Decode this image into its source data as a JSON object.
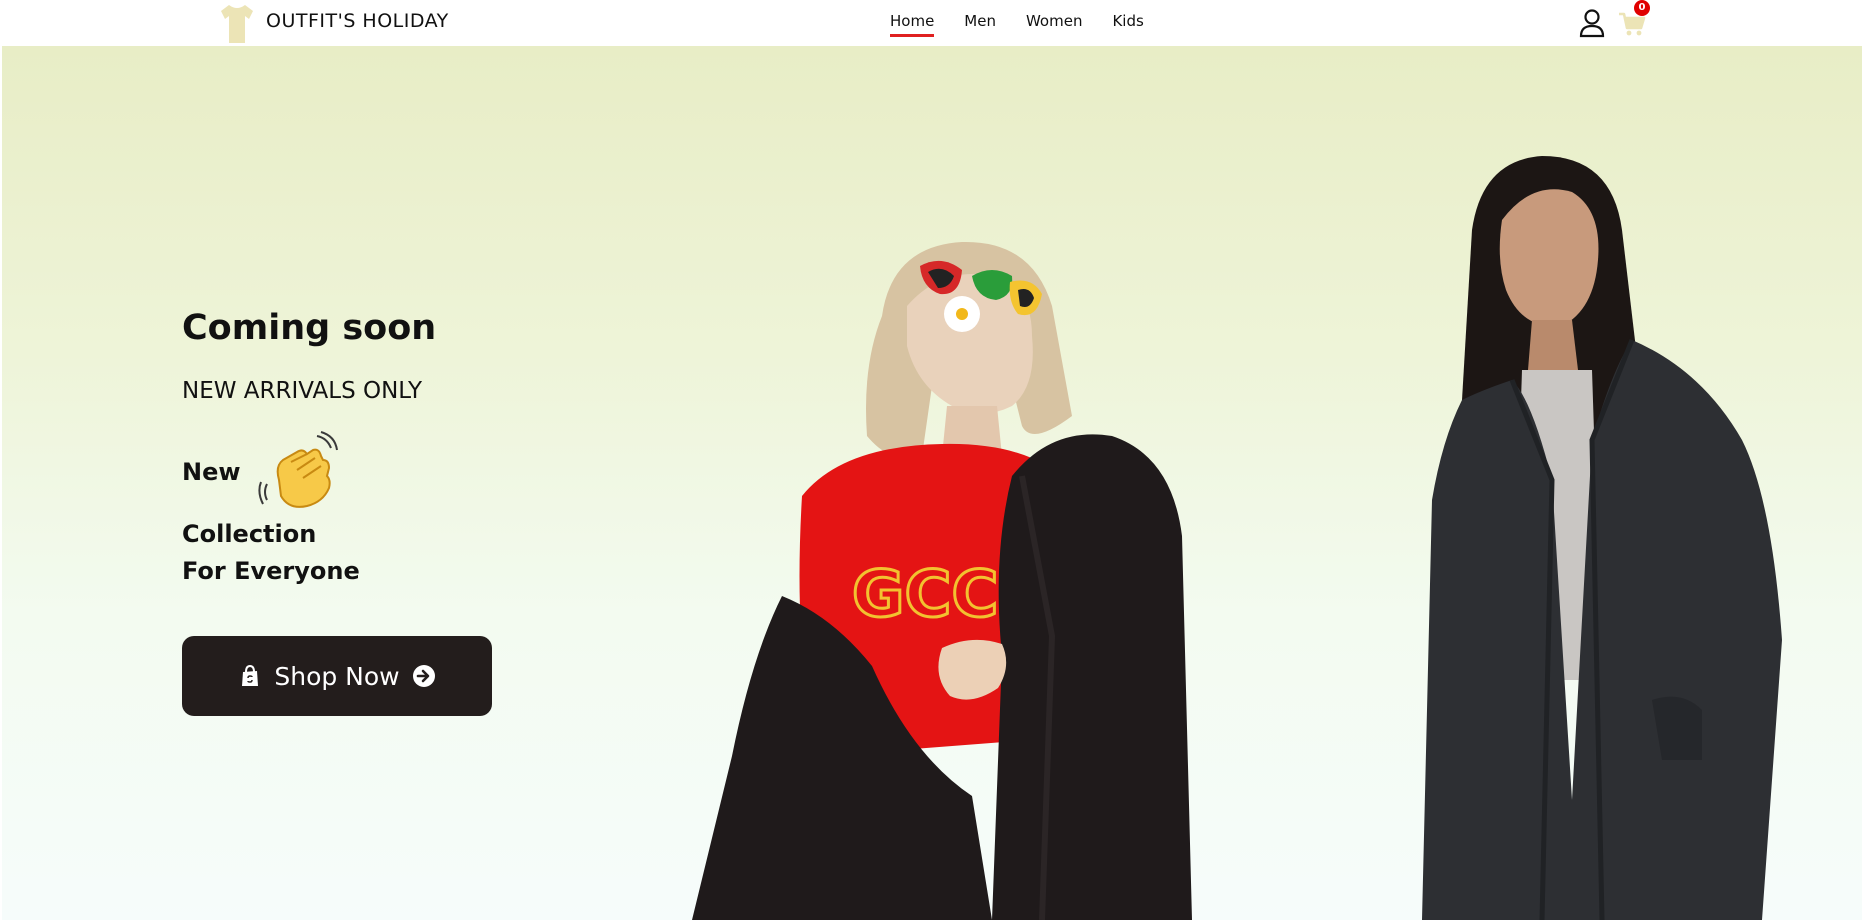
{
  "brand": {
    "name": "OUTFIT'S HOLIDAY",
    "logo_icon": "tshirt-icon",
    "logo_color": "#ece4b6"
  },
  "nav": {
    "links": [
      {
        "label": "Home",
        "active": true
      },
      {
        "label": "Men",
        "active": false
      },
      {
        "label": "Women",
        "active": false
      },
      {
        "label": "Kids",
        "active": false
      }
    ],
    "active_underline_color": "#e02020"
  },
  "header_icons": {
    "user_icon": "user-icon",
    "cart_icon": "cart-icon",
    "cart_count": "0"
  },
  "hero": {
    "title": "Coming soon",
    "subtitle": "NEW ARRIVALS ONLY",
    "line1": "New",
    "wave_icon": "waving-hand-icon",
    "line2": "Collection",
    "line3": "For Everyone",
    "cta": {
      "label": "Shop Now",
      "icon_left": "shopping-bag-icon",
      "icon_right": "arrow-circle-right-icon"
    },
    "button_color": "#231d1c"
  },
  "images": [
    {
      "name": "model-sunglasses-red-sweater-black-jacket"
    },
    {
      "name": "model-long-hair-dark-coat"
    }
  ]
}
